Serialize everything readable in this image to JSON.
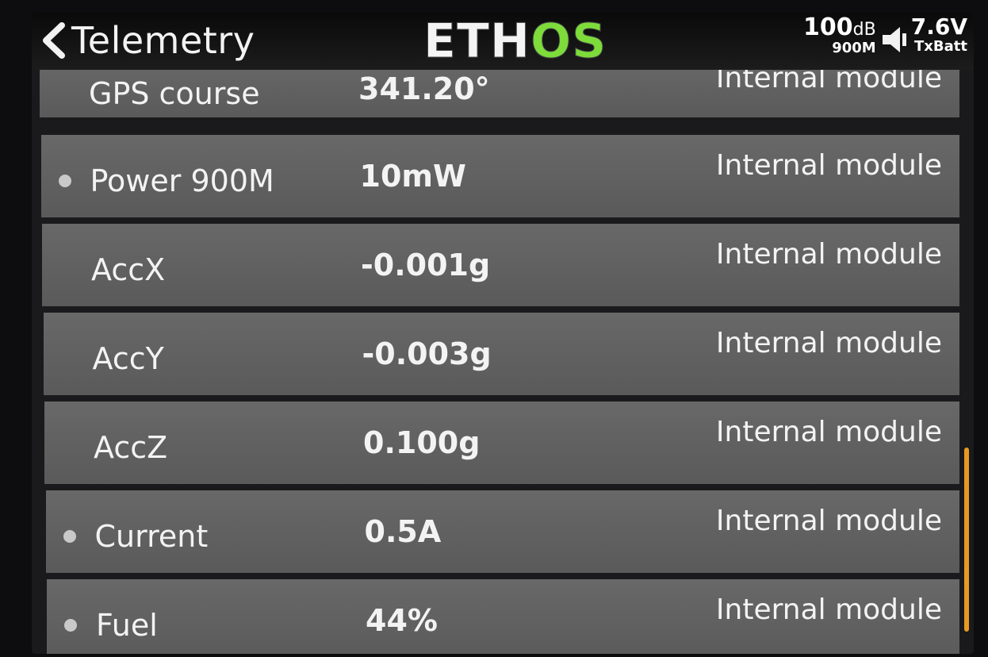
{
  "header": {
    "title": "Telemetry",
    "logo_main": "ETH",
    "logo_accent": "OS",
    "rssi_value": "100",
    "rssi_unit": "dB",
    "rssi_module": "900M",
    "battery_voltage": "7.6V",
    "battery_label": "TxBatt"
  },
  "rows": [
    {
      "name": "GPS course",
      "value": "341.20°",
      "source": "Internal module",
      "dot": false
    },
    {
      "name": "Power 900M",
      "value": "10mW",
      "source": "Internal module",
      "dot": true
    },
    {
      "name": "AccX",
      "value": "-0.001g",
      "source": "Internal module",
      "dot": false
    },
    {
      "name": "AccY",
      "value": "-0.003g",
      "source": "Internal module",
      "dot": false
    },
    {
      "name": "AccZ",
      "value": "0.100g",
      "source": "Internal module",
      "dot": false
    },
    {
      "name": "Current",
      "value": "0.5A",
      "source": "Internal module",
      "dot": true
    },
    {
      "name": "Fuel",
      "value": "44%",
      "source": "Internal module",
      "dot": true
    }
  ],
  "colors": {
    "accent": "#7ddc3a",
    "scrollbar": "#e79a22",
    "row_bg": "#626262"
  }
}
